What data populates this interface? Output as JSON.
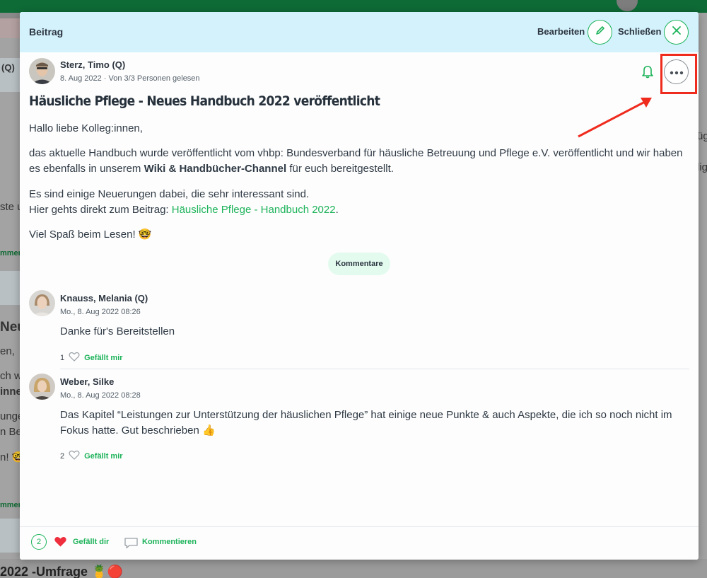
{
  "modal": {
    "title": "Beitrag",
    "edit_label": "Bearbeiten",
    "close_label": "Schließen"
  },
  "post": {
    "author": "Sterz, Timo (Q)",
    "meta": "8. Aug 2022 · Von 3/3 Personen gelesen",
    "title": "Häusliche Pflege -  Neues Handbuch 2022 veröffentlicht",
    "greeting": "Hallo liebe Kolleg:innen,",
    "p2_a": "das aktuelle Handbuch wurde veröffentlicht vom vhbp: Bundesverband für häusliche Betreuung und Pflege e.V. veröffentlicht und wir haben es ebenfalls in unserem ",
    "p2_bold": "Wiki & Handbücher-Channel",
    "p2_b": " für euch bereitgestellt.",
    "p3_line1": "Es sind einige Neuerungen dabei, die sehr interessant sind.",
    "p3_line2_a": "Hier gehts direkt zum Beitrag: ",
    "p3_link": "Häusliche Pflege -  Handbuch 2022",
    "p3_line2_b": ".",
    "closing": "Viel Spaß beim Lesen! 🤓"
  },
  "comments_button": "Kommentare",
  "comments": [
    {
      "author": "Knauss, Melania (Q)",
      "time": "Mo., 8. Aug 2022 08:26",
      "text": "Danke für's Bereitstellen",
      "likes": "1",
      "like_label": "Gefällt mir"
    },
    {
      "author": "Weber, Silke",
      "time": "Mo., 8. Aug 2022 08:28",
      "text": "Das Kapitel “Leistungen zur Unterstützung der häuslichen Pflege” hat einige neue Punkte & auch Aspekte, die ich so noch nicht im Fokus hatte. Gut beschrieben 👍",
      "likes": "2",
      "like_label": "Gefällt mir"
    }
  ],
  "footer": {
    "like_count": "2",
    "liked_label": "Gefällt dir",
    "comment_label": "Kommentieren"
  },
  "background": {
    "left_1": "(Q)",
    "left_2": "ste u",
    "left_3": "mmen",
    "left_4": "Neue",
    "left_5": "en,",
    "left_6": "ch w",
    "left_7": "inne",
    "left_8": "unge",
    "left_9": "n Be",
    "left_10": "n! 🤓",
    "left_11": "mmen",
    "right_1": "üg",
    "right_2": "lig",
    "bottom": "2022 -Umfrage 🍍🔴"
  },
  "colors": {
    "accent": "#1db35a",
    "header_bg": "#d4f2fc",
    "highlight": "#ef2b1e",
    "topbar": "#0e6b36"
  },
  "icons": [
    "pencil-icon",
    "close-icon",
    "bell-icon",
    "more-icon",
    "heart-outline-icon",
    "heart-filled-icon",
    "comment-icon"
  ]
}
